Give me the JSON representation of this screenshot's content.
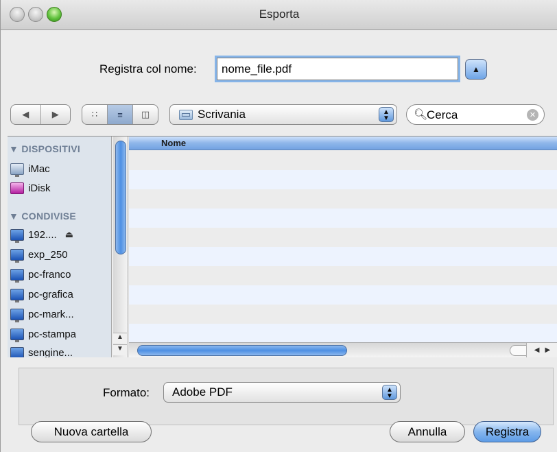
{
  "window": {
    "title": "Esporta"
  },
  "save_as": {
    "label": "Registra col nome:",
    "value": "nome_file.pdf"
  },
  "toolbar": {
    "nav": [
      "◀",
      "▶"
    ],
    "view_modes": [
      "icon-view",
      "list-view",
      "column-view"
    ],
    "location": "Scrivania",
    "search_placeholder": "Cerca"
  },
  "sidebar": {
    "sections": [
      {
        "heading": "▼ DISPOSITIVI",
        "items": [
          {
            "label": "iMac",
            "icon": "imac-icon"
          },
          {
            "label": "iDisk",
            "icon": "idisk-icon"
          }
        ]
      },
      {
        "heading": "▼ CONDIVISE",
        "items": [
          {
            "label": "192....",
            "icon": "network-computer-icon",
            "eject": "⏏"
          },
          {
            "label": "exp_250",
            "icon": "network-computer-icon"
          },
          {
            "label": "pc-franco",
            "icon": "network-computer-icon"
          },
          {
            "label": "pc-grafica",
            "icon": "network-computer-icon"
          },
          {
            "label": "pc-mark...",
            "icon": "network-computer-icon"
          },
          {
            "label": "pc-stampa",
            "icon": "network-computer-icon"
          },
          {
            "label": "sengine...",
            "icon": "network-computer-icon"
          }
        ]
      }
    ]
  },
  "file_list": {
    "column_header": "Nome",
    "rows": []
  },
  "format": {
    "label": "Formato:",
    "value": "Adobe PDF"
  },
  "buttons": {
    "new_folder": "Nuova cartella",
    "cancel": "Annulla",
    "save": "Registra"
  },
  "colors": {
    "accent": "#5d9ce6",
    "sidebar_bg": "#dde4ec",
    "row_alt": "#edf3fe"
  }
}
